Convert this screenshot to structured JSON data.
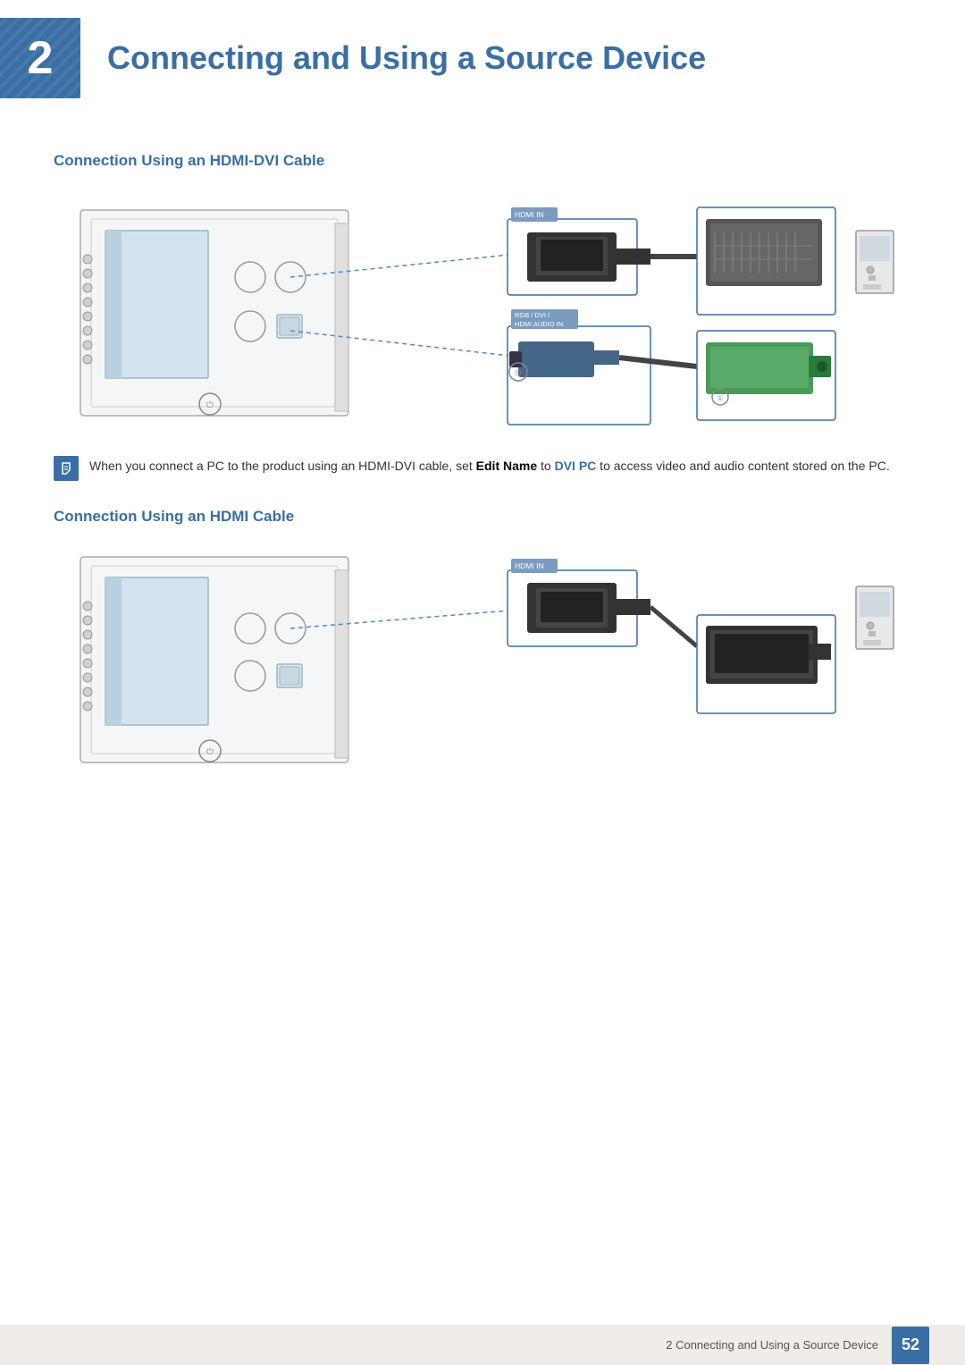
{
  "header": {
    "chapter_number": "2",
    "chapter_title": "Connecting and Using a Source Device"
  },
  "section1": {
    "heading": "Connection Using an HDMI-DVI Cable"
  },
  "section2": {
    "heading": "Connection Using an HDMI Cable"
  },
  "note": {
    "text_before": "When you connect a PC to the product using an HDMI-DVI cable, set ",
    "bold1": "Edit Name",
    "text_middle": " to ",
    "bold2": "DVI PC",
    "text_after": " to access video and audio content stored on the PC."
  },
  "labels": {
    "hdmi_in": "HDMI IN",
    "rgb_dvi": "RGB / DVI /",
    "hdmi_audio_in": "HDMI AUDIO IN"
  },
  "footer": {
    "text": "2 Connecting and Using a Source Device",
    "page": "52"
  }
}
